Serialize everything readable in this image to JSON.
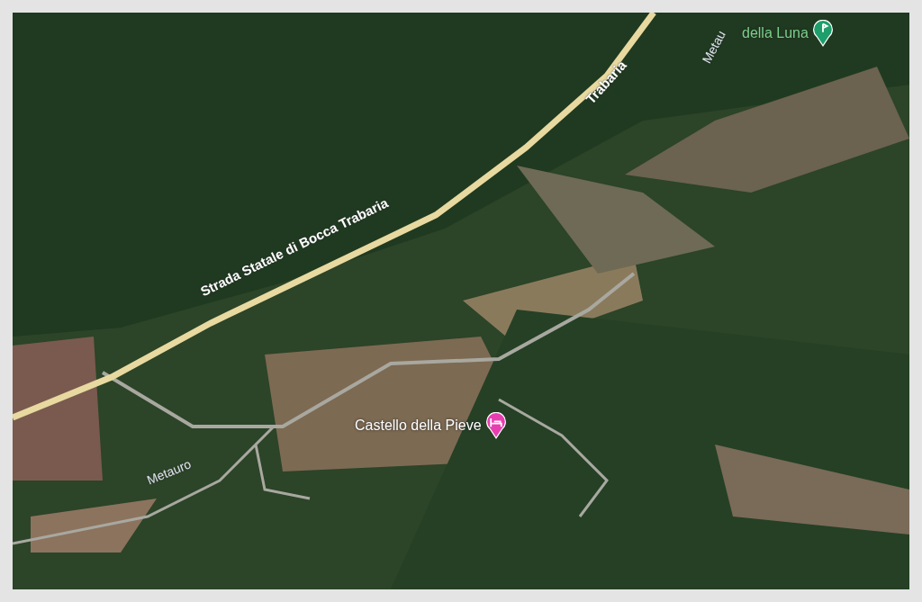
{
  "map": {
    "road_labels": [
      {
        "kind": "highway",
        "text": "Strada Statale di Bocca Trabaria"
      },
      {
        "kind": "highway",
        "text": "Trabaria"
      },
      {
        "kind": "river",
        "text": "Metau"
      },
      {
        "kind": "river",
        "text": "Metauro"
      }
    ],
    "places": [
      {
        "kind": "golf",
        "text": "della Luna"
      },
      {
        "kind": "hotel",
        "text": "Castello della Pieve"
      }
    ]
  }
}
